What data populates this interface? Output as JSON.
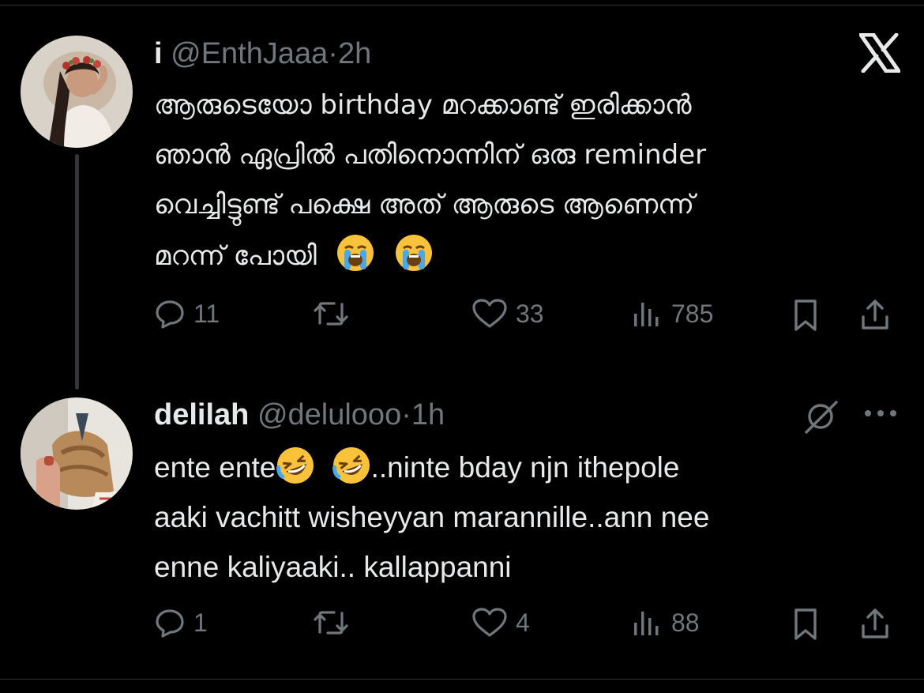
{
  "tweets": [
    {
      "display_name": "i",
      "handle": "@EnthJaaa",
      "dot": "·",
      "time": "2h",
      "lines": [
        "ആരുടെയോ birthday മറക്കാണ്ട് ഇരിക്കാൻ",
        "ഞാൻ ഏപ്രിൽ പതിനൊന്നിന് ഒരു reminder",
        "വെച്ചിട്ടുണ്ട് പക്ഷെ അത് ആരുടെ ആണെന്ന്",
        "മറന്ന് പോയി"
      ],
      "emojis": [
        "loudly-crying-face",
        "loudly-crying-face"
      ],
      "actions": {
        "replies": "11",
        "reposts": "",
        "likes": "33",
        "views": "785"
      }
    },
    {
      "display_name": "delilah",
      "handle": "@delulooo",
      "dot": "·",
      "time": "1h",
      "line1_a": "ente ente",
      "line1_b": "..ninte bday njn ithepole",
      "line2": "aaki vachitt wisheyyan marannille..ann nee",
      "line3": "enne kaliyaaki.. kallappanni",
      "emojis": [
        "rolling-on-floor-laughing",
        "rolling-on-floor-laughing"
      ],
      "actions": {
        "replies": "1",
        "reposts": "",
        "likes": "4",
        "views": "88"
      }
    }
  ],
  "icons": {
    "app_logo": "x-logo-icon",
    "reply": "reply-bubble-icon",
    "repost": "repost-icon",
    "like": "heart-icon",
    "views": "views-bar-icon",
    "bookmark": "bookmark-icon",
    "share": "share-icon",
    "grok": "grok-slash-icon",
    "more": "more-dots-icon"
  },
  "colors": {
    "background": "#000000",
    "text": "#e7e9ea",
    "muted": "#71767b",
    "divider": "#2f3336"
  }
}
